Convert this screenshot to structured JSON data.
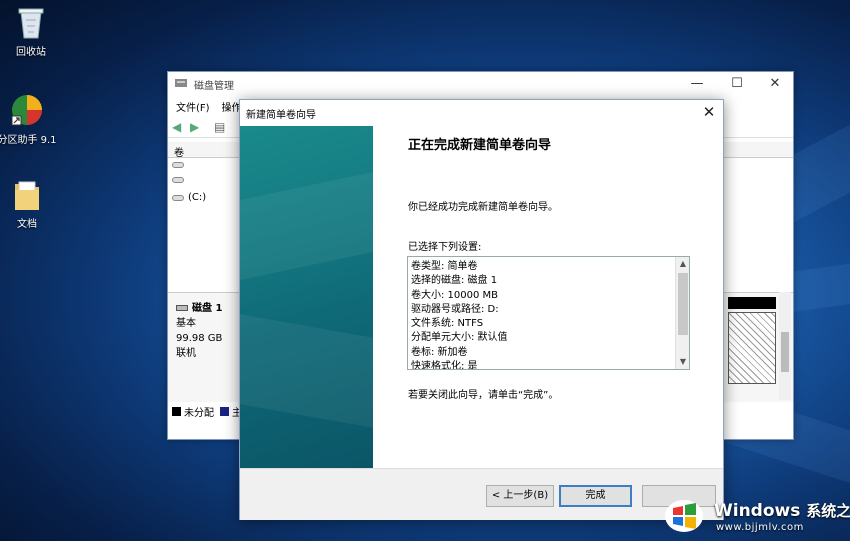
{
  "desktop": {
    "icons": [
      {
        "label": "回收站"
      },
      {
        "label": "分区助手 9.1"
      },
      {
        "label": "文档"
      }
    ]
  },
  "disk_management": {
    "title": "磁盘管理",
    "menu": [
      "文件(F)",
      "操作"
    ],
    "column_header": "卷",
    "volumes": [
      "",
      "",
      "(C:)"
    ],
    "disk": {
      "name": "磁盘 1",
      "type": "基本",
      "size": "99.98 GB",
      "status": "联机"
    },
    "legend": [
      "未分配",
      "主"
    ]
  },
  "wizard": {
    "title": "新建简单卷向导",
    "heading": "正在完成新建简单卷向导",
    "intro": "你已经成功完成新建简单卷向导。",
    "settings_label": "已选择下列设置:",
    "settings": [
      "卷类型: 简单卷",
      "选择的磁盘: 磁盘 1",
      "卷大小: 10000 MB",
      "驱动器号或路径: D:",
      "文件系统: NTFS",
      "分配单元大小: 默认值",
      "卷标: 新加卷",
      "快速格式化: 是"
    ],
    "close_hint": "若要关闭此向导，请单击“完成”。",
    "back_label": "< 上一步(B)",
    "finish_label": "完成"
  },
  "watermark": {
    "brand": "Windows",
    "brand_cn": "系统之家",
    "url": "www.bjjmlv.com"
  }
}
